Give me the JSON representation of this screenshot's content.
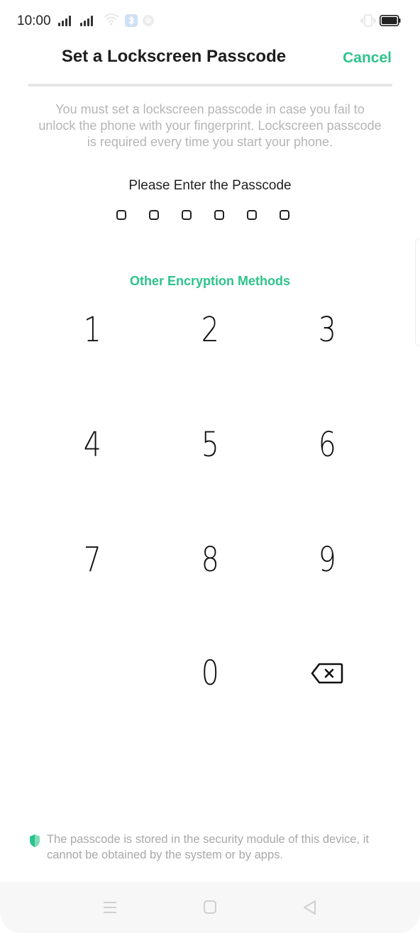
{
  "status_bar": {
    "time": "10:00",
    "icons": [
      "signal-icon",
      "signal-icon",
      "wifi-icon",
      "bluetooth-icon",
      "app-icon",
      "vibrate-icon",
      "battery-icon"
    ]
  },
  "header": {
    "title": "Set a Lockscreen Passcode",
    "cancel_label": "Cancel"
  },
  "description": "You must set a lockscreen passcode in case you fail to unlock the phone with your fingerprint. Lockscreen passcode is required every time you start your phone.",
  "passcode": {
    "prompt": "Please Enter the Passcode",
    "length": 6,
    "entered": 0
  },
  "other_methods_label": "Other Encryption Methods",
  "keypad": {
    "k1": "1",
    "k2": "2",
    "k3": "3",
    "k4": "4",
    "k5": "5",
    "k6": "6",
    "k7": "7",
    "k8": "8",
    "k9": "9",
    "k0": "0",
    "backspace_icon": "backspace-icon"
  },
  "security_note": "The passcode is stored in the security module of this device, it cannot be obtained by the system or by apps.",
  "nav_bar": {
    "icons": [
      "menu-icon",
      "home-icon",
      "back-icon"
    ]
  },
  "colors": {
    "accent": "#2dc38c",
    "text": "#222222",
    "muted": "#b5b5b5"
  }
}
